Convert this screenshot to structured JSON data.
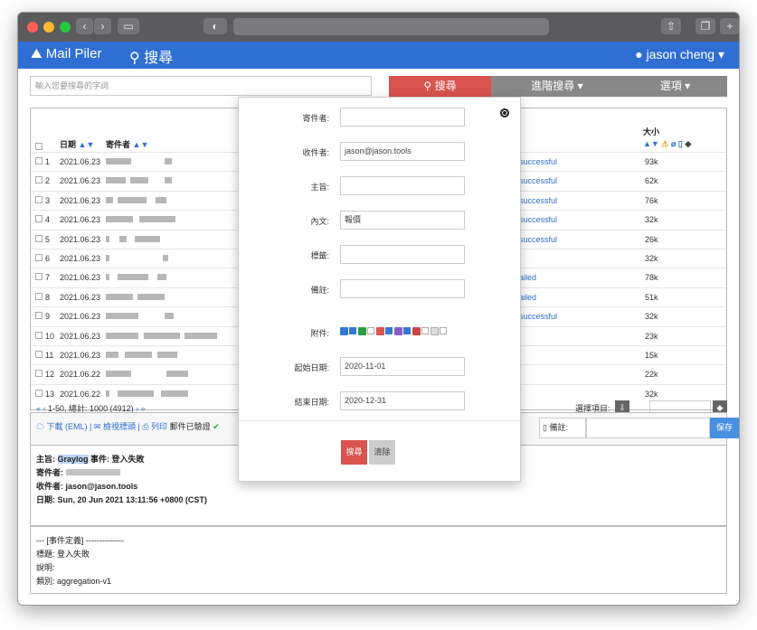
{
  "nav": {
    "brand": "Mail Piler",
    "search": "搜尋",
    "user": "jason cheng"
  },
  "search_bar": {
    "placeholder": "輸入您要搜尋的字詞",
    "search_button": "搜尋",
    "advanced_button": "進階搜尋",
    "options_button": "選項"
  },
  "table": {
    "headers": {
      "date": "日期",
      "sender": "寄件者",
      "size": "大小"
    },
    "rows": [
      {
        "num": "1",
        "date": "2021.06.23",
        "status": "successful",
        "size": "93k"
      },
      {
        "num": "2",
        "date": "2021.06.23",
        "status": "successful",
        "size": "62k"
      },
      {
        "num": "3",
        "date": "2021.06.23",
        "status": "successful",
        "size": "76k"
      },
      {
        "num": "4",
        "date": "2021.06.23",
        "status": "successful",
        "size": "32k"
      },
      {
        "num": "5",
        "date": "2021.06.23",
        "status": "successful",
        "size": "26k"
      },
      {
        "num": "6",
        "date": "2021.06.23",
        "status": "",
        "size": "32k"
      },
      {
        "num": "7",
        "date": "2021.06.23",
        "status": "ailed",
        "size": "78k"
      },
      {
        "num": "8",
        "date": "2021.06.23",
        "status": "ailed",
        "size": "51k"
      },
      {
        "num": "9",
        "date": "2021.06.23",
        "status": "successful",
        "size": "32k"
      },
      {
        "num": "10",
        "date": "2021.06.23",
        "status": "",
        "size": "23k"
      },
      {
        "num": "11",
        "date": "2021.06.23",
        "status": "",
        "size": "15k"
      },
      {
        "num": "12",
        "date": "2021.06.22",
        "status": "",
        "size": "22k"
      },
      {
        "num": "13",
        "date": "2021.06.22",
        "status": "",
        "size": "32k"
      }
    ],
    "pager": "1-50, 總計: 1000 (4912)",
    "select_label": "選擇項目:"
  },
  "preview": {
    "download": "下載 (EML)",
    "view_headers": "檢視標頭",
    "print": "列印",
    "verified": "郵件已驗證",
    "note_label": "備註:",
    "save": "保存"
  },
  "headers": {
    "subject_label": "主旨:",
    "subject_highlight": "Graylog",
    "subject_rest": "事件: 登入失敗",
    "from_label": "寄件者:",
    "to": "收件者: jason@jason.tools",
    "date": "日期: Sun, 20 Jun 2021 13:11:56 +0800 (CST)"
  },
  "body": {
    "line1": "--- [事件定義] --------------",
    "line2": "標題: 登入失敗",
    "line3": "說明:",
    "line4": "類別: aggregation-v1"
  },
  "modal": {
    "sender_label": "寄件者:",
    "sender_value": "",
    "recipient_label": "收件者:",
    "recipient_value": "jason@jason.tools",
    "subject_label": "主旨:",
    "subject_value": "",
    "body_label": "內文:",
    "body_value": "報價",
    "tag_label": "標籤:",
    "tag_value": "",
    "note_label": "備註:",
    "note_value": "",
    "attachment_label": "附件:",
    "start_label": "起始日期:",
    "start_value": "2020-11-01",
    "end_label": "結束日期:",
    "end_value": "2020-12-31",
    "search_button": "搜尋",
    "clear_button": "清除"
  },
  "colors": {
    "accent": "#2f6fd4",
    "danger": "#d9534f"
  }
}
